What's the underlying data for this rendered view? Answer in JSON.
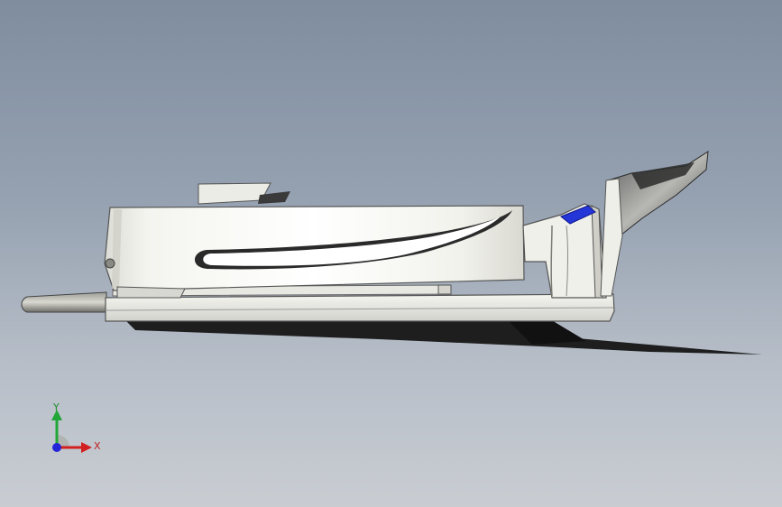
{
  "viewport": {
    "background_top": "#7f8d9f",
    "background_bottom": "#c9cdd2"
  },
  "model": {
    "body_color": "#f1f1ec",
    "shadow_color": "#1e1e1e",
    "highlight_color": "#2436d8"
  },
  "triad": {
    "x_label": "X",
    "y_label": "Y",
    "x_color": "#d21f1f",
    "y_color": "#22a637",
    "z_color": "#2424d8"
  }
}
